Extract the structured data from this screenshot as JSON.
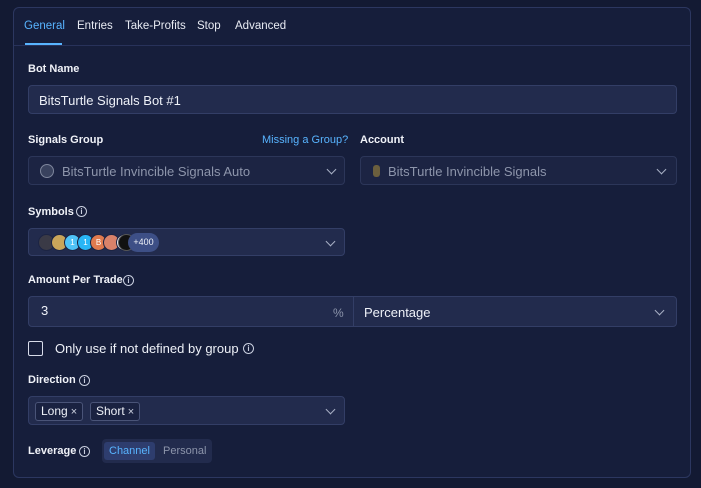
{
  "tabs": [
    {
      "label": "General",
      "active": true
    },
    {
      "label": "Entries",
      "active": false
    },
    {
      "label": "Take-Profits",
      "active": false
    },
    {
      "label": "Stop",
      "active": false
    },
    {
      "label": "Advanced",
      "active": false
    }
  ],
  "bot_name": {
    "label": "Bot Name",
    "value": "BitsTurtle Signals Bot #1"
  },
  "signals_group": {
    "label": "Signals Group",
    "missing_link": "Missing a Group?",
    "value": "BitsTurtle Invincible Signals Auto"
  },
  "account": {
    "label": "Account",
    "value": "BitsTurtle Invincible Signals"
  },
  "symbols": {
    "label": "Symbols",
    "more": "+400",
    "icons": [
      "1",
      "1",
      "B",
      "S"
    ]
  },
  "amount": {
    "label": "Amount Per Trade",
    "value": "3",
    "unit": "%",
    "type": "Percentage"
  },
  "only_use": {
    "label": "Only use if not defined by group",
    "checked": false
  },
  "direction": {
    "label": "Direction",
    "chips": [
      "Long",
      "Short"
    ],
    "remove_glyph": "×"
  },
  "leverage": {
    "label": "Leverage",
    "options": [
      "Channel",
      "Personal"
    ],
    "selected": "Channel"
  },
  "info_glyph": "i",
  "colors": {
    "accent": "#58b4ff",
    "background": "#131a33",
    "panel": "#161e3b",
    "field": "#222b4d"
  }
}
